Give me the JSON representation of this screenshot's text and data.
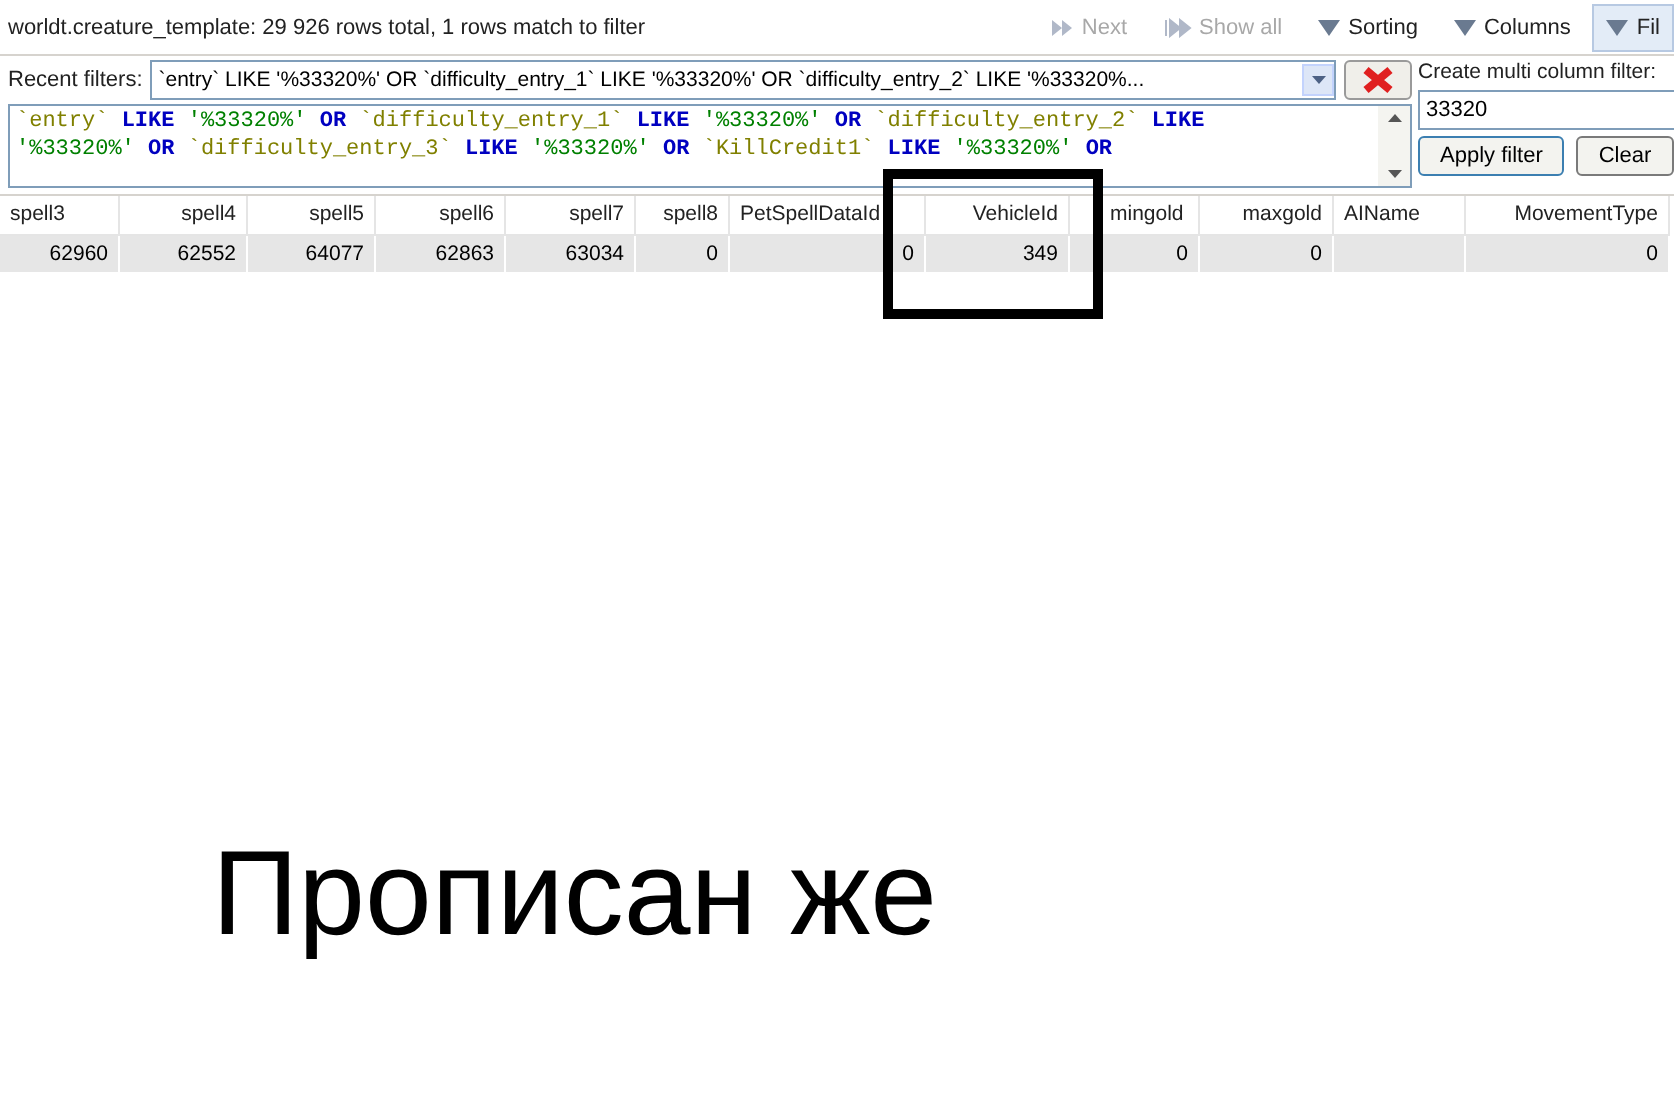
{
  "status": "worldt.creature_template: 29 926 rows total, 1 rows match to filter",
  "toolbar": [
    {
      "label": "Next",
      "kind": "next",
      "disabled": true
    },
    {
      "label": "Show all",
      "kind": "showall",
      "disabled": true
    },
    {
      "label": "Sorting",
      "kind": "menu",
      "disabled": false,
      "selected": false
    },
    {
      "label": "Columns",
      "kind": "menu",
      "disabled": false,
      "selected": false
    },
    {
      "label": "Fil",
      "kind": "menu",
      "disabled": false,
      "selected": true
    }
  ],
  "recent_filters": {
    "label": "Recent filters:",
    "value": "`entry` LIKE '%33320%' OR `difficulty_entry_1` LIKE '%33320%' OR `difficulty_entry_2` LIKE '%33320%..."
  },
  "filter_text": [
    [
      {
        "kind": "ident",
        "text": "`entry`"
      },
      {
        "kind": "keyword",
        "text": "LIKE"
      },
      {
        "kind": "string",
        "text": "'%33320%'"
      },
      {
        "kind": "keyword",
        "text": "OR"
      },
      {
        "kind": "ident",
        "text": "`difficulty_entry_1`"
      },
      {
        "kind": "keyword",
        "text": "LIKE"
      },
      {
        "kind": "string",
        "text": "'%33320%'"
      },
      {
        "kind": "keyword",
        "text": "OR"
      },
      {
        "kind": "ident",
        "text": "`difficulty_entry_2`"
      },
      {
        "kind": "keyword",
        "text": "LIKE"
      }
    ],
    [
      {
        "kind": "string",
        "text": "'%33320%'"
      },
      {
        "kind": "keyword",
        "text": "OR"
      },
      {
        "kind": "ident",
        "text": "`difficulty_entry_3`"
      },
      {
        "kind": "keyword",
        "text": "LIKE"
      },
      {
        "kind": "string",
        "text": "'%33320%'"
      },
      {
        "kind": "keyword",
        "text": "OR"
      },
      {
        "kind": "ident",
        "text": "`KillCredit1`"
      },
      {
        "kind": "keyword",
        "text": "LIKE"
      },
      {
        "kind": "string",
        "text": "'%33320%'"
      },
      {
        "kind": "keyword",
        "text": "OR"
      }
    ]
  ],
  "multi_filter": {
    "label": "Create multi column filter:",
    "value": "33320",
    "buttons": [
      "Apply filter",
      "Clear"
    ]
  },
  "table": {
    "columns": [
      "spell3",
      "spell4",
      "spell5",
      "spell6",
      "spell7",
      "spell8",
      "PetSpellDataId",
      "VehicleId",
      "mingold",
      "maxgold",
      "AIName",
      "MovementType"
    ],
    "rows": [
      [
        "62960",
        "62552",
        "64077",
        "62863",
        "63034",
        "0",
        "0",
        "349",
        "0",
        "0",
        "",
        "0"
      ]
    ]
  },
  "annotation": "Прописан же"
}
